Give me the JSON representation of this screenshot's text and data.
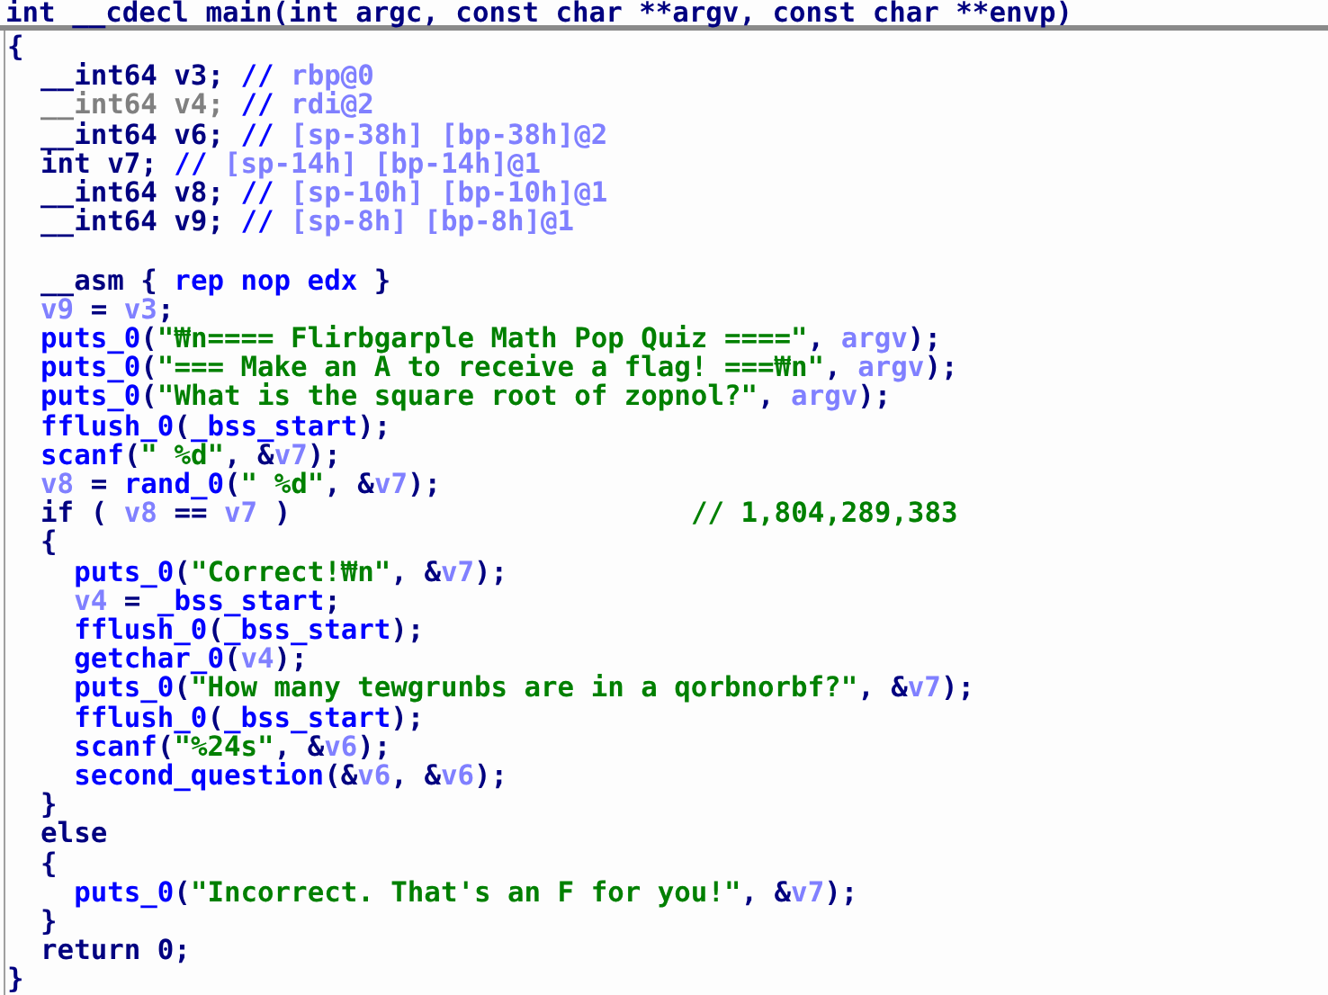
{
  "signature": [
    {
      "text": "int __cdecl main(int argc, const char **argv, const char **envp)",
      "kind": "plain"
    }
  ],
  "lines": [
    {
      "kind": "code",
      "segments": [
        {
          "text": "{",
          "kind": "plain"
        }
      ]
    },
    {
      "kind": "code",
      "segments": [
        {
          "text": "  __int64 v3; ",
          "kind": "plain"
        },
        {
          "text": "// ",
          "kind": "func"
        },
        {
          "text": "rbp@0",
          "kind": "var"
        }
      ]
    },
    {
      "kind": "code",
      "segments": [
        {
          "text": "  __int64 v4; ",
          "kind": "dead"
        },
        {
          "text": "// ",
          "kind": "func"
        },
        {
          "text": "rdi@2",
          "kind": "var"
        }
      ]
    },
    {
      "kind": "code",
      "segments": [
        {
          "text": "  __int64 v6; ",
          "kind": "plain"
        },
        {
          "text": "// ",
          "kind": "func"
        },
        {
          "text": "[sp-38h] [bp-38h]@2",
          "kind": "var"
        }
      ]
    },
    {
      "kind": "code",
      "segments": [
        {
          "text": "  int v7; ",
          "kind": "plain"
        },
        {
          "text": "// ",
          "kind": "func"
        },
        {
          "text": "[sp-14h] [bp-14h]@1",
          "kind": "var"
        }
      ]
    },
    {
      "kind": "code",
      "segments": [
        {
          "text": "  __int64 v8; ",
          "kind": "plain"
        },
        {
          "text": "// ",
          "kind": "func"
        },
        {
          "text": "[sp-10h] [bp-10h]@1",
          "kind": "var"
        }
      ]
    },
    {
      "kind": "code",
      "segments": [
        {
          "text": "  __int64 v9; ",
          "kind": "plain"
        },
        {
          "text": "// ",
          "kind": "func"
        },
        {
          "text": "[sp-8h] [bp-8h]@1",
          "kind": "var"
        }
      ]
    },
    {
      "kind": "blank"
    },
    {
      "kind": "code",
      "segments": [
        {
          "text": "  __asm { ",
          "kind": "plain"
        },
        {
          "text": "rep nop edx",
          "kind": "func"
        },
        {
          "text": " }",
          "kind": "plain"
        }
      ]
    },
    {
      "kind": "code",
      "segments": [
        {
          "text": "  v9",
          "kind": "var"
        },
        {
          "text": " = ",
          "kind": "plain"
        },
        {
          "text": "v3",
          "kind": "var"
        },
        {
          "text": ";",
          "kind": "plain"
        }
      ]
    },
    {
      "kind": "code",
      "segments": [
        {
          "text": "  puts_0",
          "kind": "func"
        },
        {
          "text": "(",
          "kind": "plain"
        },
        {
          "text": "\"₩n==== Flirbgarple Math Pop Quiz ====\"",
          "kind": "string"
        },
        {
          "text": ", ",
          "kind": "plain"
        },
        {
          "text": "argv",
          "kind": "var"
        },
        {
          "text": ");",
          "kind": "plain"
        }
      ]
    },
    {
      "kind": "code",
      "segments": [
        {
          "text": "  puts_0",
          "kind": "func"
        },
        {
          "text": "(",
          "kind": "plain"
        },
        {
          "text": "\"=== Make an A to receive a flag! ===₩n\"",
          "kind": "string"
        },
        {
          "text": ", ",
          "kind": "plain"
        },
        {
          "text": "argv",
          "kind": "var"
        },
        {
          "text": ");",
          "kind": "plain"
        }
      ]
    },
    {
      "kind": "code",
      "segments": [
        {
          "text": "  puts_0",
          "kind": "func"
        },
        {
          "text": "(",
          "kind": "plain"
        },
        {
          "text": "\"What is the square root of zopnol?\"",
          "kind": "string"
        },
        {
          "text": ", ",
          "kind": "plain"
        },
        {
          "text": "argv",
          "kind": "var"
        },
        {
          "text": ");",
          "kind": "plain"
        }
      ]
    },
    {
      "kind": "code",
      "segments": [
        {
          "text": "  fflush_0",
          "kind": "func"
        },
        {
          "text": "(",
          "kind": "plain"
        },
        {
          "text": "_bss_start",
          "kind": "func"
        },
        {
          "text": ");",
          "kind": "plain"
        }
      ]
    },
    {
      "kind": "code",
      "segments": [
        {
          "text": "  scanf",
          "kind": "func"
        },
        {
          "text": "(",
          "kind": "plain"
        },
        {
          "text": "\" %d\"",
          "kind": "string"
        },
        {
          "text": ", &",
          "kind": "plain"
        },
        {
          "text": "v7",
          "kind": "var"
        },
        {
          "text": ");",
          "kind": "plain"
        }
      ]
    },
    {
      "kind": "code",
      "segments": [
        {
          "text": "  v8",
          "kind": "var"
        },
        {
          "text": " = ",
          "kind": "plain"
        },
        {
          "text": "rand_0",
          "kind": "func"
        },
        {
          "text": "(",
          "kind": "plain"
        },
        {
          "text": "\" %d\"",
          "kind": "string"
        },
        {
          "text": ", &",
          "kind": "plain"
        },
        {
          "text": "v7",
          "kind": "var"
        },
        {
          "text": ");",
          "kind": "plain"
        }
      ]
    },
    {
      "kind": "code",
      "segments": [
        {
          "text": "  if ( ",
          "kind": "plain"
        },
        {
          "text": "v8",
          "kind": "var"
        },
        {
          "text": " == ",
          "kind": "plain"
        },
        {
          "text": "v7",
          "kind": "var"
        },
        {
          "text": " )                        ",
          "kind": "plain"
        },
        {
          "text": "// 1,804,289,383",
          "kind": "string"
        }
      ]
    },
    {
      "kind": "code",
      "segments": [
        {
          "text": "  {",
          "kind": "plain"
        }
      ]
    },
    {
      "kind": "code",
      "segments": [
        {
          "text": "    puts_0",
          "kind": "func"
        },
        {
          "text": "(",
          "kind": "plain"
        },
        {
          "text": "\"Correct!₩n\"",
          "kind": "string"
        },
        {
          "text": ", &",
          "kind": "plain"
        },
        {
          "text": "v7",
          "kind": "var"
        },
        {
          "text": ");",
          "kind": "plain"
        }
      ]
    },
    {
      "kind": "code",
      "segments": [
        {
          "text": "    v4",
          "kind": "var"
        },
        {
          "text": " = ",
          "kind": "plain"
        },
        {
          "text": "_bss_start",
          "kind": "func"
        },
        {
          "text": ";",
          "kind": "plain"
        }
      ]
    },
    {
      "kind": "code",
      "segments": [
        {
          "text": "    fflush_0",
          "kind": "func"
        },
        {
          "text": "(",
          "kind": "plain"
        },
        {
          "text": "_bss_start",
          "kind": "func"
        },
        {
          "text": ");",
          "kind": "plain"
        }
      ]
    },
    {
      "kind": "code",
      "segments": [
        {
          "text": "    getchar_0",
          "kind": "func"
        },
        {
          "text": "(",
          "kind": "plain"
        },
        {
          "text": "v4",
          "kind": "var"
        },
        {
          "text": ");",
          "kind": "plain"
        }
      ]
    },
    {
      "kind": "code",
      "segments": [
        {
          "text": "    puts_0",
          "kind": "func"
        },
        {
          "text": "(",
          "kind": "plain"
        },
        {
          "text": "\"How many tewgrunbs are in a qorbnorbf?\"",
          "kind": "string"
        },
        {
          "text": ", &",
          "kind": "plain"
        },
        {
          "text": "v7",
          "kind": "var"
        },
        {
          "text": ");",
          "kind": "plain"
        }
      ]
    },
    {
      "kind": "code",
      "segments": [
        {
          "text": "    fflush_0",
          "kind": "func"
        },
        {
          "text": "(",
          "kind": "plain"
        },
        {
          "text": "_bss_start",
          "kind": "func"
        },
        {
          "text": ");",
          "kind": "plain"
        }
      ]
    },
    {
      "kind": "code",
      "segments": [
        {
          "text": "    scanf",
          "kind": "func"
        },
        {
          "text": "(",
          "kind": "plain"
        },
        {
          "text": "\"%24s\"",
          "kind": "string"
        },
        {
          "text": ", &",
          "kind": "plain"
        },
        {
          "text": "v6",
          "kind": "var"
        },
        {
          "text": ");",
          "kind": "plain"
        }
      ]
    },
    {
      "kind": "code",
      "segments": [
        {
          "text": "    second_question",
          "kind": "func"
        },
        {
          "text": "(&",
          "kind": "plain"
        },
        {
          "text": "v6",
          "kind": "var"
        },
        {
          "text": ", &",
          "kind": "plain"
        },
        {
          "text": "v6",
          "kind": "var"
        },
        {
          "text": ");",
          "kind": "plain"
        }
      ]
    },
    {
      "kind": "code",
      "segments": [
        {
          "text": "  }",
          "kind": "plain"
        }
      ]
    },
    {
      "kind": "code",
      "segments": [
        {
          "text": "  else",
          "kind": "plain"
        }
      ]
    },
    {
      "kind": "code",
      "segments": [
        {
          "text": "  {",
          "kind": "plain"
        }
      ]
    },
    {
      "kind": "code",
      "segments": [
        {
          "text": "    puts_0",
          "kind": "func"
        },
        {
          "text": "(",
          "kind": "plain"
        },
        {
          "text": "\"Incorrect. That's an F for you!\"",
          "kind": "string"
        },
        {
          "text": ", &",
          "kind": "plain"
        },
        {
          "text": "v7",
          "kind": "var"
        },
        {
          "text": ");",
          "kind": "plain"
        }
      ]
    },
    {
      "kind": "code",
      "segments": [
        {
          "text": "  }",
          "kind": "plain"
        }
      ]
    },
    {
      "kind": "code",
      "segments": [
        {
          "text": "  return 0;",
          "kind": "plain"
        }
      ]
    },
    {
      "kind": "code",
      "segments": [
        {
          "text": "}",
          "kind": "plain"
        }
      ]
    }
  ]
}
